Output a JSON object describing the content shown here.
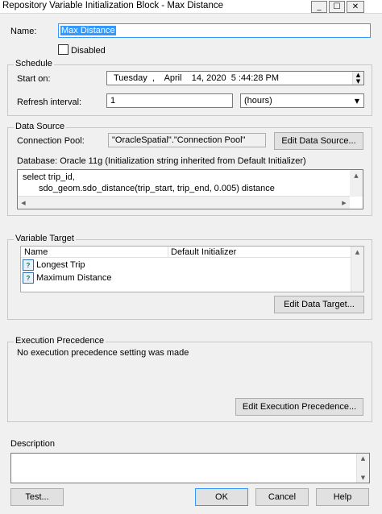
{
  "window": {
    "title": "Repository Variable Initialization Block - Max Distance",
    "min": "_",
    "max": "☐",
    "close": "✕"
  },
  "name": {
    "label": "Name:",
    "value": "Max Distance"
  },
  "disabled": {
    "label": "Disabled",
    "checked": false
  },
  "schedule": {
    "legend": "Schedule",
    "start_label": "Start on:",
    "start_value": "Tuesday  ,    April    14, 2020  5 :44:28 PM",
    "refresh_label": "Refresh interval:",
    "refresh_value": "1",
    "refresh_unit": "(hours)"
  },
  "data_source": {
    "legend": "Data Source",
    "conn_label": "Connection Pool:",
    "conn_value": "\"OracleSpatial\".\"Connection Pool\"",
    "edit_button": "Edit Data Source...",
    "database_text": "Database: Oracle 11g (Initialization string inherited from Default Initializer)",
    "sql_line1": "select trip_id,",
    "sql_line2": "sdo_geom.sdo_distance(trip_start, trip_end, 0.005) distance"
  },
  "variable_target": {
    "legend": "Variable Target",
    "columns": [
      "Name",
      "Default Initializer"
    ],
    "rows": [
      {
        "name": "Longest Trip",
        "default": ""
      },
      {
        "name": "Maximum Distance",
        "default": ""
      }
    ],
    "edit_button": "Edit Data Target..."
  },
  "execution": {
    "legend": "Execution Precedence",
    "text": "No execution precedence setting was made",
    "edit_button": "Edit Execution Precedence..."
  },
  "description": {
    "label": "Description",
    "value": ""
  },
  "buttons": {
    "test": "Test...",
    "ok": "OK",
    "cancel": "Cancel",
    "help": "Help"
  },
  "colors": {
    "selection": "#3399ff",
    "accent_border": "#3399ff"
  }
}
